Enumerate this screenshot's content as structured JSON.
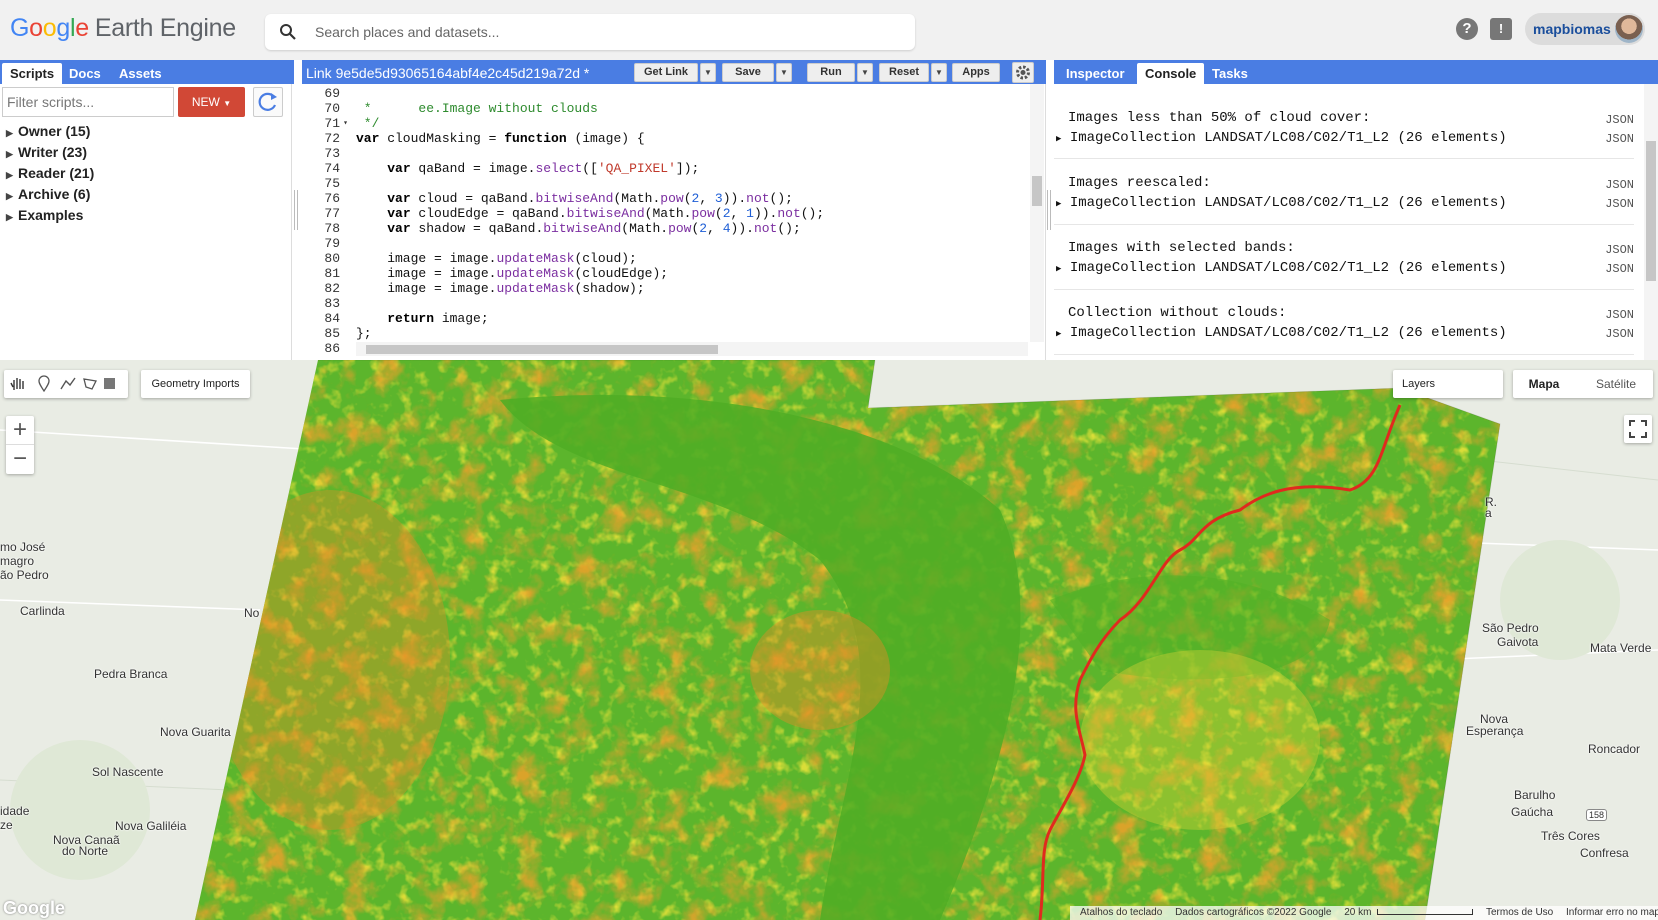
{
  "app": {
    "logo_google": "Google",
    "logo_product": "Earth Engine",
    "user": "mapbiomas"
  },
  "search": {
    "placeholder": "Search places and datasets..."
  },
  "left_panel": {
    "tabs": [
      "Scripts",
      "Docs",
      "Assets"
    ],
    "filter_placeholder": "Filter scripts...",
    "new_label": "NEW",
    "tree": [
      "Owner (15)",
      "Writer (23)",
      "Reader (21)",
      "Archive (6)",
      "Examples"
    ]
  },
  "editor": {
    "title": "Link 9e5de5d93065164abf4e2c45d219a72d *",
    "buttons": {
      "get_link": "Get Link",
      "save": "Save",
      "run": "Run",
      "reset": "Reset",
      "apps": "Apps"
    },
    "line_numbers": [
      "69",
      "70",
      "71",
      "72",
      "73",
      "74",
      "75",
      "76",
      "77",
      "78",
      "79",
      "80",
      "81",
      "82",
      "83",
      "84",
      "85",
      "86"
    ]
  },
  "right_panel": {
    "tabs": [
      "Inspector",
      "Console",
      "Tasks"
    ],
    "json_label": "JSON",
    "logs": [
      {
        "title": "Images less than 50% of cloud cover:",
        "value": "ImageCollection LANDSAT/LC08/C02/T1_L2 (26 elements)"
      },
      {
        "title": "Images reescaled:",
        "value": "ImageCollection LANDSAT/LC08/C02/T1_L2 (26 elements)"
      },
      {
        "title": "Images with selected bands:",
        "value": "ImageCollection LANDSAT/LC08/C02/T1_L2 (26 elements)"
      },
      {
        "title": "Collection without clouds:",
        "value": "ImageCollection LANDSAT/LC08/C02/T1_L2 (26 elements)"
      }
    ]
  },
  "map": {
    "geometry_imports": "Geometry Imports",
    "layers": "Layers",
    "map_types": [
      "Mapa",
      "Satélite"
    ],
    "zoom_in": "+",
    "zoom_out": "−",
    "google_watermark": "Google",
    "places": [
      "mo José",
      "magro",
      "ão Pedro",
      "Carlinda",
      "No",
      "Pedra Branca",
      "Nova Guarita",
      "Sol Nascente",
      "idade",
      "ze",
      "Nova Galiléia",
      "Nova Canaã",
      "do Norte",
      "São Pedro",
      "Gaivota",
      "Mata Verde",
      "Nova",
      "Esperança",
      "Roncador",
      "Barulho",
      "Gaúcha",
      "158",
      "Três Cores",
      "Confresa",
      "R.",
      "a"
    ],
    "attribution": {
      "shortcuts": "Atalhos do teclado",
      "data": "Dados cartográficos ©2022 Google",
      "scale": "20 km",
      "terms": "Termos de Uso",
      "report": "Informar erro no mapa"
    }
  },
  "colors": {
    "header_blue": "#4a7de3",
    "new_red": "#d14836",
    "ndvi_green": "#54b72a",
    "ndvi_yellow": "#e8e53a",
    "ndvi_orange": "#f0962a",
    "river_red": "#e02a1e"
  }
}
